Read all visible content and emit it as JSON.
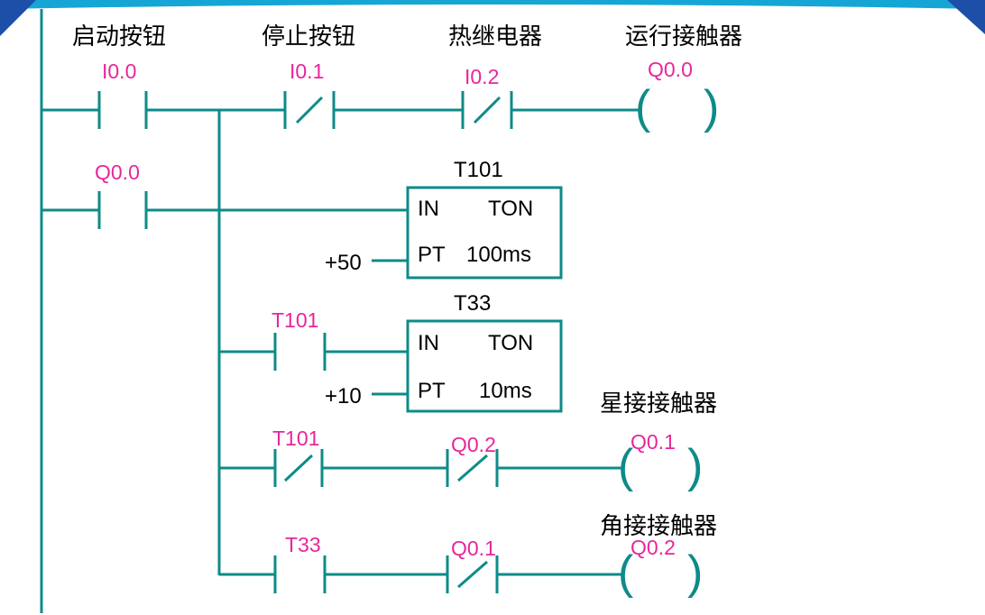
{
  "colors": {
    "wire": "#0e8b88",
    "address": "#e8269a",
    "text": "#000000",
    "banner": "#16a6d6"
  },
  "header_labels": {
    "start_button": "启动按钮",
    "stop_button": "停止按钮",
    "thermal_relay": "热继电器",
    "run_contactor": "运行接触器"
  },
  "rungs": {
    "rung1": {
      "contact_start": "I0.0",
      "contact_stop": "I0.1",
      "contact_thermal": "I0.2",
      "coil_run": "Q0.0"
    },
    "rung2": {
      "contact_seal": "Q0.0"
    },
    "timer1": {
      "name": "T101",
      "in": "IN",
      "type": "TON",
      "pt": "PT",
      "base": "100ms",
      "preset": "+50"
    },
    "timer2": {
      "contact": "T101",
      "name": "T33",
      "in": "IN",
      "type": "TON",
      "pt": "PT",
      "base": "10ms",
      "preset": "+10"
    },
    "star": {
      "label": "星接接触器",
      "contact_timer": "T101",
      "contact_interlock": "Q0.2",
      "coil": "Q0.1"
    },
    "delta": {
      "label": "角接接触器",
      "contact_timer": "T33",
      "contact_interlock": "Q0.1",
      "coil": "Q0.2"
    }
  },
  "parens": {
    "open": "(",
    "close": ")"
  }
}
